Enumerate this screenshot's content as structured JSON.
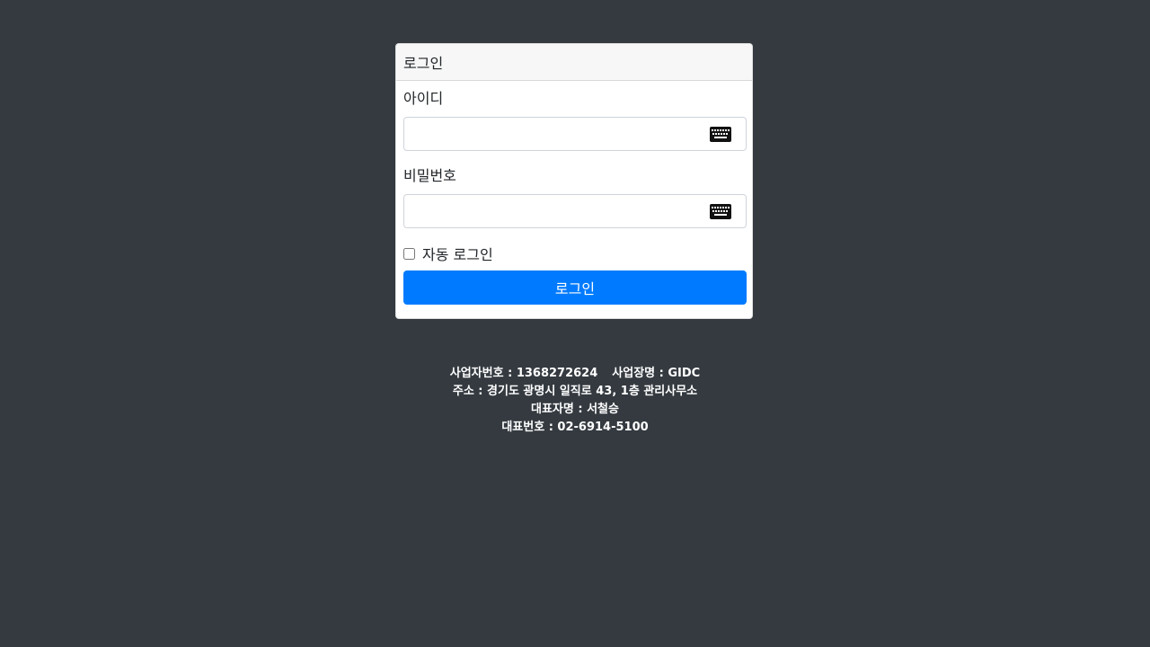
{
  "login_card": {
    "title": "로그인",
    "id_label": "아이디",
    "password_label": "비밀번호",
    "id_value": "",
    "password_value": "",
    "auto_login_label": "자동 로그인",
    "auto_login_checked": false,
    "submit_label": "로그인",
    "keyboard_icon": "keyboard-icon"
  },
  "footer": {
    "business_number": "사업자번호 : 1368272624",
    "business_name": "사업장명 : GIDC",
    "address": "주소 : 경기도 광명시 일직로 43, 1층 관리사무소",
    "representative": "대표자명 : 서철승",
    "phone": "대표번호 : 02-6914-5100"
  },
  "colors": {
    "background": "#343a40",
    "primary": "#007bff",
    "card_header": "#f7f7f7"
  }
}
